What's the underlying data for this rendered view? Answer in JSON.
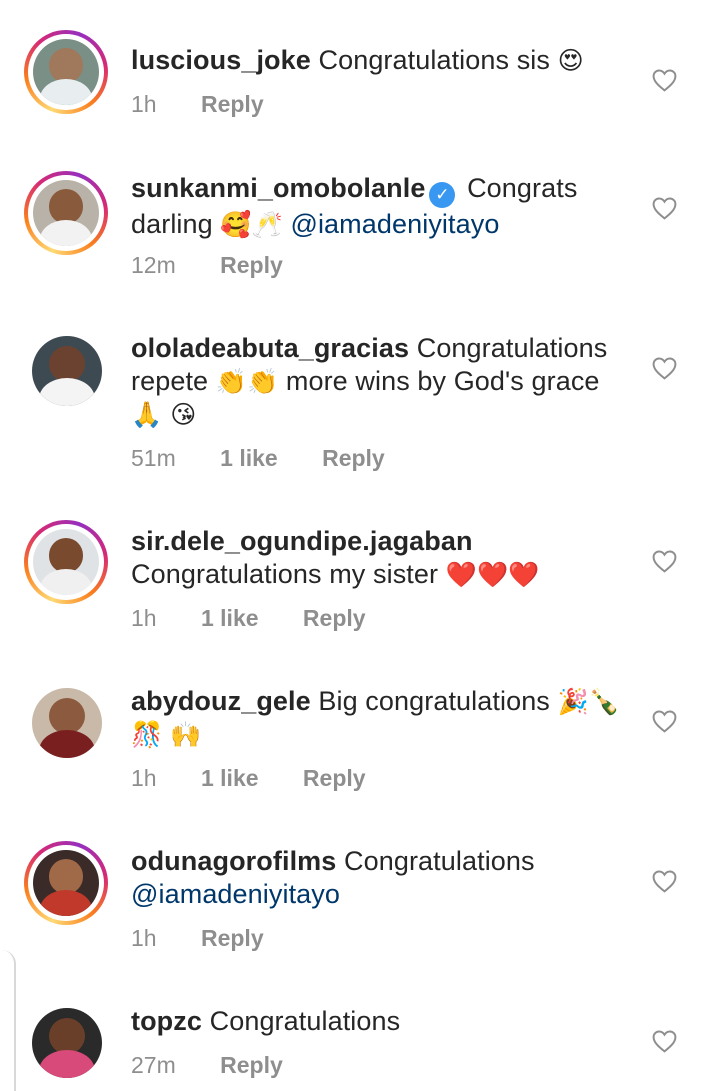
{
  "comments": [
    {
      "username": "luscious_joke",
      "text": "Congratulations sis",
      "emoji": "😍",
      "time": "1h",
      "likes": "",
      "reply": "Reply",
      "colors": {
        "skin": "#a0785c",
        "shirt": "#e8eef0",
        "bg": "#7a8f86"
      }
    },
    {
      "username": "sunkanmi_omobolanle",
      "text_before": "Congrats",
      "text_line2": "darling",
      "emoji": "🥰🥂",
      "mention": "@iamadeniyitayo",
      "time": "12m",
      "likes": "",
      "reply": "Reply",
      "colors": {
        "skin": "#8a5a3c",
        "shirt": "#f2f2f2",
        "bg": "#b9b2a8"
      }
    },
    {
      "username": "ololadeabuta_gracias",
      "text_line1": "Congratulations",
      "text_line2a": "repete",
      "emoji_a": "👏👏",
      "text_line2b": "more wins by God's grace",
      "emoji_b": "🙏 😘",
      "time": "51m",
      "likes": "1 like",
      "reply": "Reply",
      "colors": {
        "skin": "#6b4230",
        "shirt": "#f4f4f4",
        "bg": "#3e4a52"
      }
    },
    {
      "username": "sir.dele_ogundipe.jagaban",
      "text": "Congratulations my sister",
      "emoji": "❤️❤️❤️",
      "time": "1h",
      "likes": "1 like",
      "reply": "Reply",
      "colors": {
        "skin": "#7a4a2e",
        "shirt": "#f0f0f0",
        "bg": "#dfe3e6"
      }
    },
    {
      "username": "abydouz_gele",
      "text": "Big congratulations",
      "emoji": "🎉🍾",
      "emoji_line2": "🎊 🙌",
      "time": "1h",
      "likes": "1 like",
      "reply": "Reply",
      "colors": {
        "skin": "#8c5a3e",
        "shirt": "#7a1f1f",
        "bg": "#c9b9a8"
      }
    },
    {
      "username": "odunagorofilms",
      "text": "Congratulations",
      "mention": "@iamadeniyitayo",
      "time": "1h",
      "likes": "",
      "reply": "Reply",
      "colors": {
        "skin": "#a06a48",
        "shirt": "#c0392b",
        "bg": "#3a2a28"
      }
    },
    {
      "username": "topzc",
      "text": "Congratulations",
      "time": "27m",
      "likes": "",
      "reply": "Reply",
      "colors": {
        "skin": "#6a3f2a",
        "shirt": "#d84a7a",
        "bg": "#2a2a2a"
      }
    }
  ]
}
